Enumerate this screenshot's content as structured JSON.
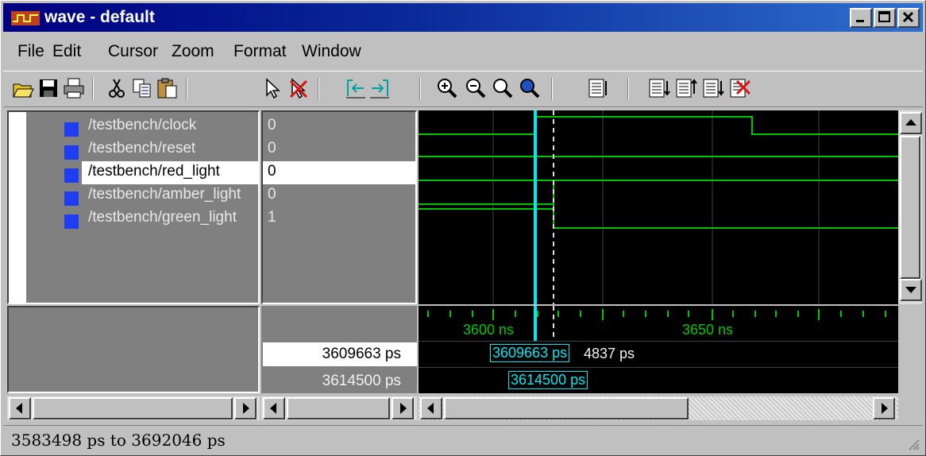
{
  "window": {
    "title": "wave - default"
  },
  "title_buttons": [
    "minimize",
    "maximize",
    "close"
  ],
  "menu": [
    "File",
    "Edit",
    "Cursor",
    "Zoom",
    "Format",
    "Window"
  ],
  "toolbar_icons": [
    "open-icon",
    "save-icon",
    "print-icon",
    "cut-icon",
    "copy-icon",
    "paste-icon",
    "select-icon",
    "delete-icon",
    "cursor-left-icon",
    "cursor-right-icon",
    "zoom-in-icon",
    "zoom-out-icon",
    "zoom-area-icon",
    "zoom-full-icon",
    "format-icon",
    "sort1-icon",
    "sort2-icon",
    "sort3-icon",
    "delete-signals-icon"
  ],
  "signals": [
    {
      "name": "/testbench/clock",
      "value": "0"
    },
    {
      "name": "/testbench/reset",
      "value": "0"
    },
    {
      "name": "/testbench/red_light",
      "value": "0"
    },
    {
      "name": "/testbench/amber_light",
      "value": "0"
    },
    {
      "name": "/testbench/green_light",
      "value": "1"
    }
  ],
  "selected_signal": 2,
  "timeline": {
    "tick1": "3600 ns",
    "tick2": "3650 ns"
  },
  "cursors": {
    "cursor1_value": "3609663 ps",
    "cursor2_value": "3614500 ps",
    "cursor1_label": "3609663 ps",
    "cursor2_label": "3614500 ps",
    "delta": "4837 ps"
  },
  "status": {
    "range": "3583498 ps to 3692046 ps"
  },
  "colors": {
    "wave": "#00c800",
    "cursor": "#00e8f0",
    "selected_sq": "#1c3ef0"
  }
}
